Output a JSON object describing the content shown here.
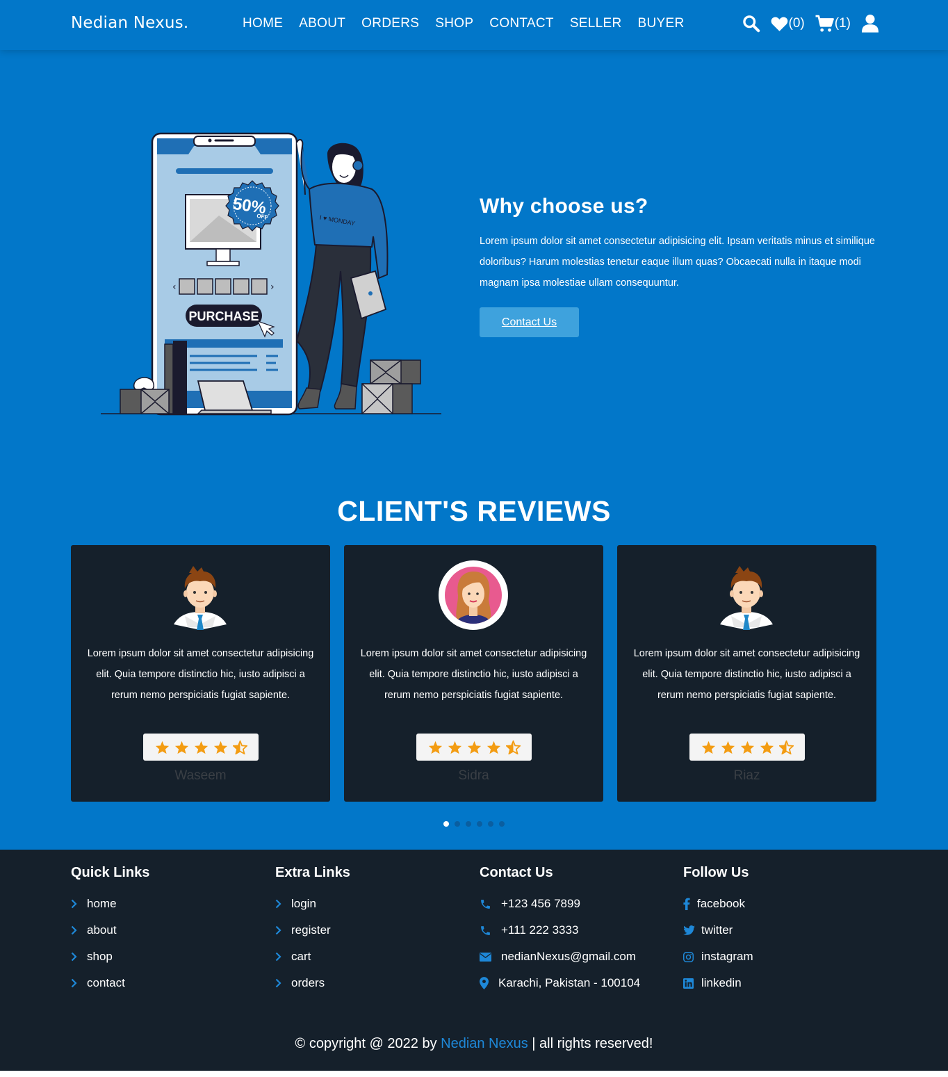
{
  "header": {
    "logo": "Nedian Nexus.",
    "nav": [
      "HOME",
      "ABOUT",
      "ORDERS",
      "SHOP",
      "CONTACT",
      "SELLER",
      "BUYER"
    ],
    "wishlist_count": "(0)",
    "cart_count": "(1)",
    "icons": [
      "search-icon",
      "heart-icon",
      "cart-icon",
      "user-icon"
    ]
  },
  "hero": {
    "illustration": {
      "badge_text": "50%",
      "badge_sub": "OFF",
      "purchase_label": "PURCHASE",
      "shirt_text": "I ♥ MONDAY"
    },
    "title": "Why choose us?",
    "text": "Lorem ipsum dolor sit amet consectetur adipisicing elit. Ipsam veritatis minus et similique doloribus? Harum molestias tenetur eaque illum quas? Obcaecati nulla in itaque modi magnam ipsa molestiae ullam consequuntur.",
    "button": "Contact Us"
  },
  "reviews": {
    "title": "CLIENT'S REVIEWS",
    "items": [
      {
        "name": "Waseem",
        "avatar": "man-avatar",
        "rating": 4.5,
        "text": "Lorem ipsum dolor sit amet consectetur adipisicing elit. Quia tempore distinctio hic, iusto adipisci a rerum nemo perspiciatis fugiat sapiente."
      },
      {
        "name": "Sidra",
        "avatar": "woman-avatar",
        "rating": 4.5,
        "text": "Lorem ipsum dolor sit amet consectetur adipisicing elit. Quia tempore distinctio hic, iusto adipisci a rerum nemo perspiciatis fugiat sapiente."
      },
      {
        "name": "Riaz",
        "avatar": "man-avatar",
        "rating": 4.5,
        "text": "Lorem ipsum dolor sit amet consectetur adipisicing elit. Quia tempore distinctio hic, iusto adipisci a rerum nemo perspiciatis fugiat sapiente."
      }
    ],
    "pagination_count": 6,
    "active_page": 1
  },
  "footer": {
    "quick_links": {
      "title": "Quick Links",
      "items": [
        "home",
        "about",
        "shop",
        "contact"
      ]
    },
    "extra_links": {
      "title": "Extra Links",
      "items": [
        "login",
        "register",
        "cart",
        "orders"
      ]
    },
    "contact": {
      "title": "Contact Us",
      "items": [
        {
          "icon": "phone-icon",
          "text": "+123 456 7899"
        },
        {
          "icon": "phone-icon",
          "text": "+111 222 3333"
        },
        {
          "icon": "envelope-icon",
          "text": "nedianNexus@gmail.com"
        },
        {
          "icon": "map-marker-icon",
          "text": "Karachi, Pakistan - 100104"
        }
      ]
    },
    "follow": {
      "title": "Follow Us",
      "items": [
        {
          "icon": "facebook-icon",
          "text": "facebook"
        },
        {
          "icon": "twitter-icon",
          "text": "twitter"
        },
        {
          "icon": "instagram-icon",
          "text": "instagram"
        },
        {
          "icon": "linkedin-icon",
          "text": "linkedin"
        }
      ]
    },
    "copyright_prefix": "© copyright @ 2022 by ",
    "copyright_brand": "Nedian Nexus",
    "copyright_suffix": " | all rights reserved!"
  },
  "colors": {
    "primary": "#0277c9",
    "dark": "#15202b",
    "star": "#f39c12",
    "button": "#3ea2dd"
  }
}
